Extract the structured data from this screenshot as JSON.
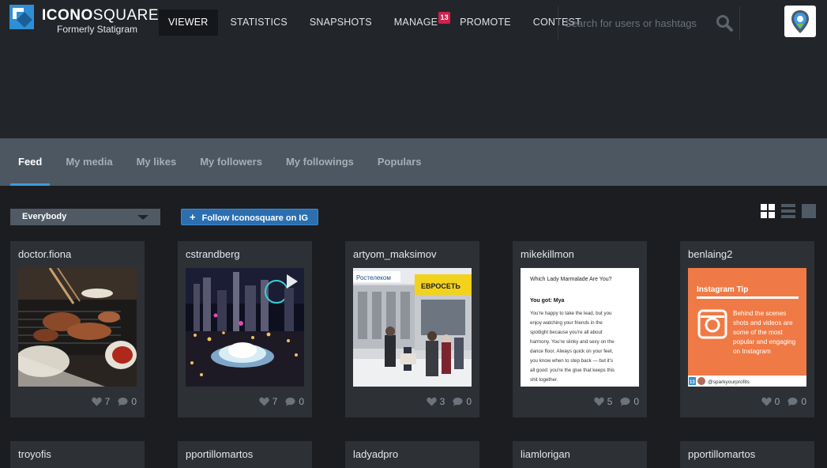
{
  "brand": {
    "name_bold": "ICONO",
    "name_light": "SQUARE",
    "tagline": "Formerly Statigram"
  },
  "nav": {
    "items": [
      {
        "label": "VIEWER",
        "active": true
      },
      {
        "label": "STATISTICS",
        "active": false
      },
      {
        "label": "SNAPSHOTS",
        "active": false
      },
      {
        "label": "MANAGE",
        "active": false,
        "badge": "13"
      },
      {
        "label": "PROMOTE",
        "active": false
      },
      {
        "label": "CONTEST",
        "active": false
      }
    ]
  },
  "search": {
    "placeholder": "Search for users or hashtags",
    "icon": "search-icon"
  },
  "account": {
    "icon": "location-pin-icon"
  },
  "subtabs": [
    {
      "label": "Feed",
      "active": true
    },
    {
      "label": "My media",
      "active": false
    },
    {
      "label": "My likes",
      "active": false
    },
    {
      "label": "My followers",
      "active": false
    },
    {
      "label": "My followings",
      "active": false
    },
    {
      "label": "Populars",
      "active": false
    }
  ],
  "filter": {
    "selected": "Everybody",
    "follow_label": "Follow Iconosquare on IG"
  },
  "view_modes": [
    "grid-view-icon",
    "list-view-icon",
    "single-view-icon"
  ],
  "posts": [
    {
      "user": "doctor.fiona",
      "likes": "7",
      "comments": "0",
      "photo": "bbq-dinner"
    },
    {
      "user": "cstrandberg",
      "likes": "7",
      "comments": "0",
      "photo": "city-night-fountain",
      "video": true
    },
    {
      "user": "artyom_maksimov",
      "likes": "3",
      "comments": "0",
      "photo": "street-market"
    },
    {
      "user": "mikekillmon",
      "likes": "5",
      "comments": "0",
      "photo": "quiz-result"
    },
    {
      "user": "benlaing2",
      "likes": "0",
      "comments": "0",
      "photo": "instagram-tip"
    }
  ],
  "posts_row2": [
    {
      "user": "troyofis"
    },
    {
      "user": "pportillomartos"
    },
    {
      "user": "ladyadpro"
    },
    {
      "user": "liamlorigan"
    },
    {
      "user": "pportillomartos"
    }
  ],
  "photo_text": {
    "market_sign_left": "Ростелеком",
    "market_sign_right": "ЕВРОСЕТЬ",
    "quiz_title": "Which Lady Marmalade Are You?",
    "quiz_result": "You got: Mya",
    "quiz_body": [
      "You're happy to take the lead, but you",
      "enjoy watching your friends in the",
      "spotlight because you're all about",
      "harmony. You're slinky and sexy on the",
      "dance floor. Always quick on your feet,",
      "you know when to step back — but it's",
      "all good: you're the glue that keeps this",
      "shit together."
    ],
    "tip_title": "Instagram Tip",
    "tip_body": [
      "Behind the scenes",
      "shots and videos are",
      "some of the most",
      "popular and engaging",
      "on Instagram"
    ],
    "tip_footer": "@sparkyourprofits",
    "tip_footer_badge": "13"
  },
  "colors": {
    "accent": "#3d9be0",
    "badge": "#d2204c",
    "tip_orange": "#f07a45"
  }
}
